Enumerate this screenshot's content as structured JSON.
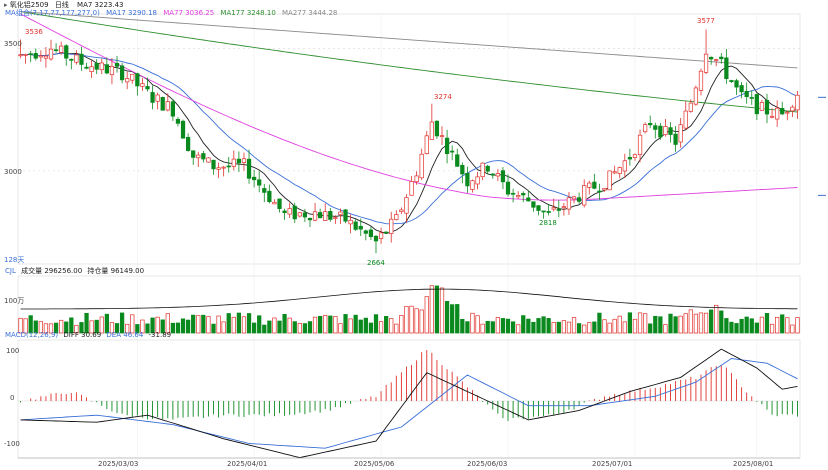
{
  "window": {
    "title": "氧化铝2509",
    "period": "日线"
  },
  "colors": {
    "up": "#e0302a",
    "down": "#0a8a1e",
    "ma7": "#222222",
    "ma17": "#3a6fd8",
    "ma77": "#e040e0",
    "ma177": "#2f8f2f",
    "ma277": "#888888",
    "grid": "#d8d8d8"
  },
  "price_panel": {
    "legend_prefix": "MA组合(7,17,77,177,277,0)",
    "ma7_label": "MA7 3223.43",
    "ma17_label": "MA17 3290.18",
    "ma77_label": "MA77 3036.25",
    "ma177_label": "MA177 3248.10",
    "ma277_label": "MA277 3444.28",
    "y_ticks": [
      "3500",
      "3000"
    ],
    "high_label": "3577",
    "left_high_label": "3536",
    "mid_high_label": "3274",
    "low_label": "2664",
    "mid_low_label": "2818",
    "days_label": "128天"
  },
  "volume_panel": {
    "legend_prefix": "CJL",
    "volume_label": "成交量 296256.00",
    "oi_label": "持仓量 96149.00",
    "y_tick": "100万"
  },
  "macd_panel": {
    "legend_prefix": "MACD(12,26,9)",
    "diff_label": "DIFF 30.69",
    "dea_label": "DEA 46.64",
    "macd_label": "-31.89",
    "y_ticks": [
      "100",
      "0",
      "-100"
    ]
  },
  "x_axis": {
    "labels": [
      "2025/03/03",
      "2025/04/01",
      "2025/05/06",
      "2025/06/03",
      "2025/07/01",
      "2025/08/01"
    ]
  },
  "chart_data": {
    "type": "candlestick",
    "ylim": [
      2620,
      3640
    ],
    "anchors": [
      [
        0,
        3470,
        3536
      ],
      [
        6,
        3500,
        3520
      ],
      [
        12,
        3440,
        3460
      ],
      [
        20,
        3400,
        3420
      ],
      [
        26,
        3300,
        3330
      ],
      [
        30,
        3250,
        3270
      ],
      [
        34,
        3060,
        3090
      ],
      [
        38,
        3020,
        3040
      ],
      [
        44,
        3020,
        3040
      ],
      [
        48,
        2920,
        2950
      ],
      [
        52,
        2820,
        2840
      ],
      [
        58,
        2830,
        2850
      ],
      [
        64,
        2800,
        2810
      ],
      [
        70,
        2710,
        2680
      ],
      [
        74,
        2800,
        2820
      ],
      [
        78,
        3000,
        3020
      ],
      [
        81,
        3200,
        3274
      ],
      [
        84,
        3100,
        3120
      ],
      [
        88,
        2960,
        2990
      ],
      [
        92,
        3020,
        3040
      ],
      [
        96,
        2920,
        2940
      ],
      [
        100,
        2880,
        2900
      ],
      [
        104,
        2818,
        2840
      ],
      [
        110,
        2900,
        2920
      ],
      [
        116,
        2970,
        2990
      ],
      [
        120,
        3060,
        3080
      ],
      [
        124,
        3200,
        3220
      ],
      [
        129,
        3120,
        3140
      ],
      [
        132,
        3280,
        3300
      ],
      [
        135,
        3500,
        3577
      ],
      [
        138,
        3430,
        3460
      ],
      [
        142,
        3300,
        3320
      ],
      [
        146,
        3250,
        3270
      ],
      [
        150,
        3230,
        3250
      ],
      [
        153,
        3320,
        3350
      ]
    ],
    "macd_hist_anchors": [
      [
        0,
        0
      ],
      [
        10,
        20
      ],
      [
        20,
        -30
      ],
      [
        30,
        -40
      ],
      [
        40,
        -30
      ],
      [
        50,
        -30
      ],
      [
        60,
        -20
      ],
      [
        70,
        10
      ],
      [
        80,
        110
      ],
      [
        85,
        60
      ],
      [
        95,
        -40
      ],
      [
        105,
        -30
      ],
      [
        115,
        10
      ],
      [
        125,
        30
      ],
      [
        133,
        50
      ],
      [
        138,
        80
      ],
      [
        143,
        20
      ],
      [
        148,
        -30
      ],
      [
        153,
        -30
      ]
    ],
    "diff_anchors": [
      [
        0,
        -40
      ],
      [
        15,
        -45
      ],
      [
        25,
        -30
      ],
      [
        40,
        -80
      ],
      [
        55,
        -120
      ],
      [
        70,
        -85
      ],
      [
        80,
        60
      ],
      [
        88,
        20
      ],
      [
        100,
        -40
      ],
      [
        110,
        -20
      ],
      [
        120,
        20
      ],
      [
        130,
        50
      ],
      [
        138,
        110
      ],
      [
        145,
        70
      ],
      [
        150,
        25
      ],
      [
        153,
        31
      ]
    ],
    "dea_anchors": [
      [
        0,
        -40
      ],
      [
        15,
        -30
      ],
      [
        30,
        -50
      ],
      [
        45,
        -90
      ],
      [
        60,
        -100
      ],
      [
        75,
        -55
      ],
      [
        88,
        55
      ],
      [
        100,
        -10
      ],
      [
        112,
        -10
      ],
      [
        125,
        10
      ],
      [
        133,
        40
      ],
      [
        140,
        90
      ],
      [
        147,
        80
      ],
      [
        153,
        47
      ]
    ]
  }
}
